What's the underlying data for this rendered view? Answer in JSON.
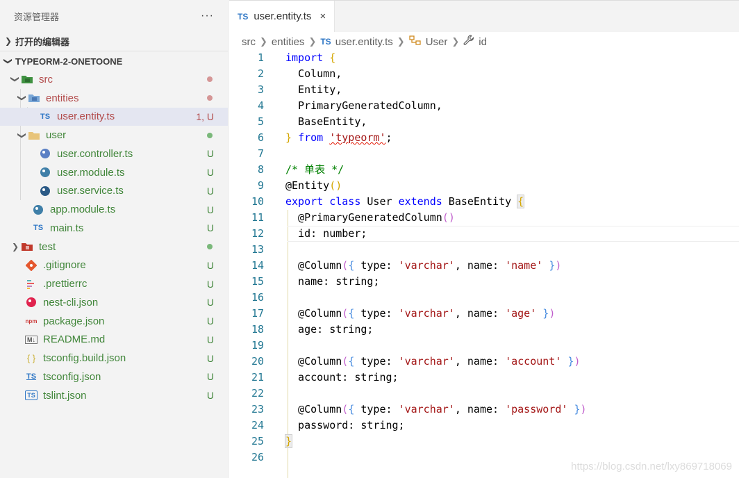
{
  "explorer": {
    "title": "资源管理器",
    "more_label": "···",
    "open_editors_label": "打开的编辑器",
    "project_label": "TYPEORM-2-ONETOONE"
  },
  "tree": [
    {
      "name": "src",
      "badge": "",
      "dot": "red"
    },
    {
      "name": "entities",
      "badge": "",
      "dot": "red"
    },
    {
      "name": "user.entity.ts",
      "badge": "1, U"
    },
    {
      "name": "user",
      "badge": "",
      "dot": "green"
    },
    {
      "name": "user.controller.ts",
      "badge": "U"
    },
    {
      "name": "user.module.ts",
      "badge": "U"
    },
    {
      "name": "user.service.ts",
      "badge": "U"
    },
    {
      "name": "app.module.ts",
      "badge": "U"
    },
    {
      "name": "main.ts",
      "badge": "U"
    },
    {
      "name": "test",
      "badge": "",
      "dot": "green"
    },
    {
      "name": ".gitignore",
      "badge": "U"
    },
    {
      "name": ".prettierrc",
      "badge": "U"
    },
    {
      "name": "nest-cli.json",
      "badge": "U"
    },
    {
      "name": "package.json",
      "badge": "U"
    },
    {
      "name": "README.md",
      "badge": "U"
    },
    {
      "name": "tsconfig.build.json",
      "badge": "U"
    },
    {
      "name": "tsconfig.json",
      "badge": "U"
    },
    {
      "name": "tslint.json",
      "badge": "U"
    }
  ],
  "icons": {
    "ts_label": "TS",
    "md_label": "M↓",
    "npm_label": "npm",
    "json_label": "{ }"
  },
  "tab": {
    "file_type": "TS",
    "title": "user.entity.ts",
    "close": "×"
  },
  "breadcrumb": {
    "items": [
      "src",
      "entities",
      "user.entity.ts",
      "User",
      "id"
    ]
  },
  "code": {
    "line_numbers": [
      "1",
      "2",
      "3",
      "4",
      "5",
      "6",
      "7",
      "8",
      "9",
      "10",
      "11",
      "12",
      "13",
      "14",
      "15",
      "16",
      "17",
      "18",
      "19",
      "20",
      "21",
      "22",
      "23",
      "24",
      "25",
      "26"
    ],
    "lines": [
      "import {",
      "  Column,",
      "  Entity,",
      "  PrimaryGeneratedColumn,",
      "  BaseEntity,",
      "} from 'typeorm';",
      "",
      "/* 单表 */",
      "@Entity()",
      "export class User extends BaseEntity {",
      "  @PrimaryGeneratedColumn()",
      "  id: number;",
      "",
      "  @Column({ type: 'varchar', name: 'name' })",
      "  name: string;",
      "",
      "  @Column({ type: 'varchar', name: 'age' })",
      "  age: string;",
      "",
      "  @Column({ type: 'varchar', name: 'account' })",
      "  account: string;",
      "",
      "  @Column({ type: 'varchar', name: 'password' })",
      "  password: string;",
      "}",
      ""
    ]
  },
  "watermark": "https://blog.csdn.net/lxy869718069"
}
